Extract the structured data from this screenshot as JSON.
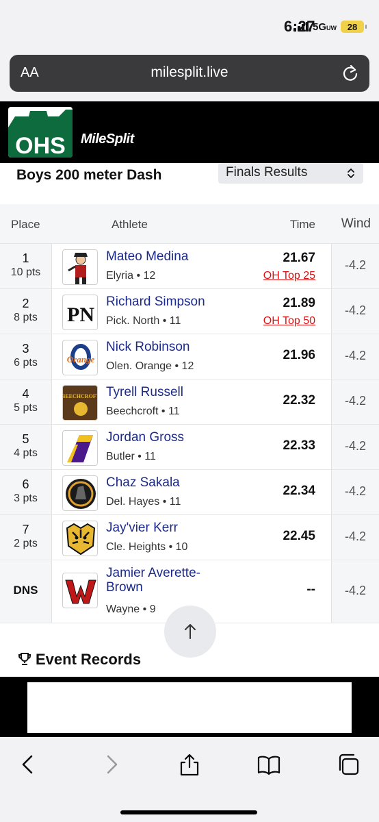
{
  "status": {
    "time": "6:27",
    "network": "5G",
    "network_sub": "UW",
    "battery": "28"
  },
  "browser": {
    "text_size": "AA",
    "url": "milesplit.live"
  },
  "site": {
    "logo_text": "OHS",
    "brand": "MileSplit"
  },
  "event": {
    "title": "Boys 200 meter Dash",
    "round_select": "Finals Results"
  },
  "table": {
    "headers": {
      "place": "Place",
      "athlete": "Athlete",
      "time": "Time",
      "wind": "Wind"
    },
    "rows": [
      {
        "place": "1",
        "points": "10 pts",
        "name": "Mateo Medina",
        "team": "Elyria • 12",
        "time": "21.67",
        "rank": "OH Top 25",
        "wind": "-4.2"
      },
      {
        "place": "2",
        "points": "8 pts",
        "name": "Richard Simpson",
        "team": "Pick. North • 11",
        "time": "21.89",
        "rank": "OH Top 50",
        "wind": "-4.2"
      },
      {
        "place": "3",
        "points": "6 pts",
        "name": "Nick Robinson",
        "team": "Olen. Orange • 12",
        "time": "21.96",
        "rank": "",
        "wind": "-4.2"
      },
      {
        "place": "4",
        "points": "5 pts",
        "name": "Tyrell Russell",
        "team": "Beechcroft • 11",
        "time": "22.32",
        "rank": "",
        "wind": "-4.2"
      },
      {
        "place": "5",
        "points": "4 pts",
        "name": "Jordan Gross",
        "team": "Butler • 11",
        "time": "22.33",
        "rank": "",
        "wind": "-4.2"
      },
      {
        "place": "6",
        "points": "3 pts",
        "name": "Chaz Sakala",
        "team": "Del. Hayes • 11",
        "time": "22.34",
        "rank": "",
        "wind": "-4.2"
      },
      {
        "place": "7",
        "points": "2 pts",
        "name": "Jay'vier Kerr",
        "team": "Cle. Heights • 10",
        "time": "22.45",
        "rank": "",
        "wind": "-4.2"
      },
      {
        "place": "DNS",
        "points": "",
        "name": "Jamier Averette-Brown",
        "team": "Wayne • 9",
        "time": "--",
        "rank": "",
        "wind": "-4.2"
      }
    ],
    "logo_texts": {
      "beechcroft": "BEECHCROFT",
      "orange": "Orange"
    }
  },
  "records_heading": "Event Records",
  "colors": {
    "link": "#1c2a8a",
    "rank": "#dd1111",
    "header": "#000000",
    "logo_green": "#0e6b3d"
  }
}
